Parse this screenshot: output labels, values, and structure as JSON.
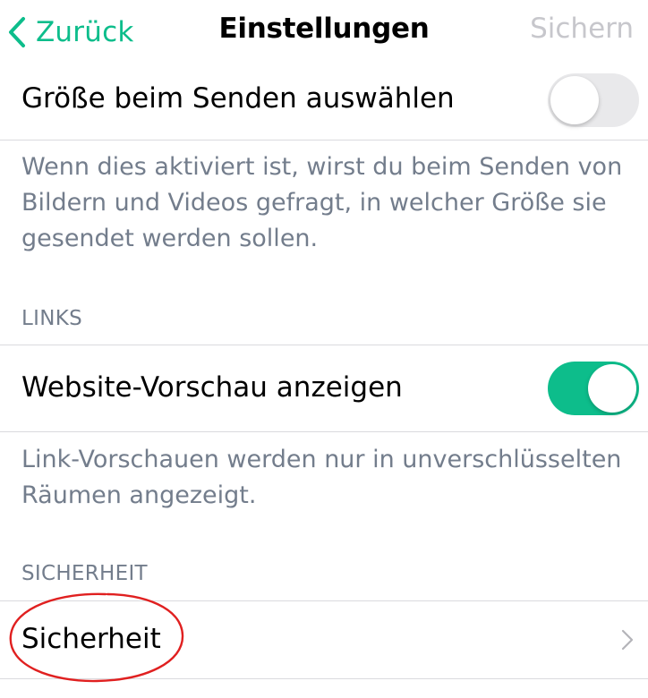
{
  "navbar": {
    "back_label": "Zurück",
    "title": "Einstellungen",
    "save_label": "Sichern"
  },
  "media": {
    "size_toggle_label": "Größe beim Senden auswählen",
    "size_toggle_state": "off",
    "size_footer": "Wenn dies aktiviert ist, wirst du beim Senden von Bildern und Videos gefragt, in welcher Größe sie gesendet werden sollen."
  },
  "links": {
    "header": "LINKS",
    "preview_label": "Website-Vorschau anzeigen",
    "preview_state": "on",
    "footer": "Link-Vorschauen werden nur in unverschlüsselten Räumen angezeigt."
  },
  "security": {
    "header": "SICHERHEIT",
    "item_label": "Sicherheit"
  },
  "colors": {
    "accent": "#0DBD8B",
    "secondary_text": "#737d8c",
    "disabled": "#c7c7cc",
    "annotation": "#e02020"
  },
  "icons": {
    "back": "chevron-left-icon",
    "disclosure": "chevron-right-icon"
  }
}
